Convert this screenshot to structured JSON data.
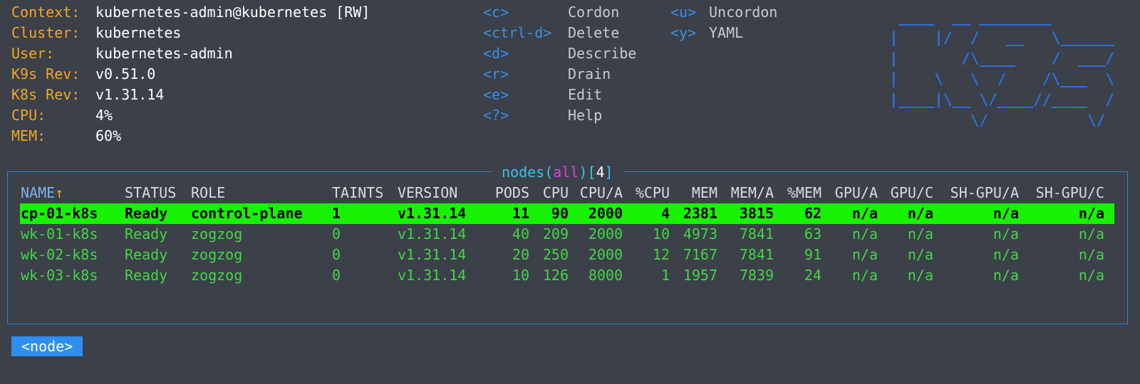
{
  "header": {
    "info": [
      {
        "label": "Context:",
        "value": "kubernetes-admin@kubernetes [RW]"
      },
      {
        "label": "Cluster:",
        "value": "kubernetes"
      },
      {
        "label": "User:",
        "value": "kubernetes-admin"
      },
      {
        "label": "K9s Rev:",
        "value": "v0.51.0"
      },
      {
        "label": "K8s Rev:",
        "value": "v1.31.14"
      },
      {
        "label": "CPU:",
        "value": "4%"
      },
      {
        "label": "MEM:",
        "value": "60%"
      }
    ],
    "shortcuts": [
      {
        "key": "<c>",
        "action": "Cordon"
      },
      {
        "key": "<ctrl-d>",
        "action": "Delete"
      },
      {
        "key": "<d>",
        "action": "Describe"
      },
      {
        "key": "<r>",
        "action": "Drain"
      },
      {
        "key": "<e>",
        "action": "Edit"
      },
      {
        "key": "<?>",
        "action": "Help"
      },
      {
        "key": "<u>",
        "action": "Uncordon"
      },
      {
        "key": "<y>",
        "action": "YAML"
      }
    ],
    "logo": " ____  __ ________       \n|    |/  /   __   \\______\n|       /\\____    /  ___/\n|    \\   \\  /    /\\___  \\\n|____|\\__ \\/____//____  /\n         \\/           \\/ "
  },
  "table": {
    "title_resource": "nodes",
    "title_open": "(",
    "title_ns": "all",
    "title_close": ")",
    "title_count_open": "[",
    "title_count": "4",
    "title_count_close": "]",
    "columns": [
      "NAME↑",
      "STATUS",
      "ROLE",
      "TAINTS",
      "VERSION",
      "PODS",
      "CPU",
      "CPU/A",
      "%CPU",
      "MEM",
      "MEM/A",
      "%MEM",
      "GPU/A",
      "GPU/C",
      "SH-GPU/A",
      "SH-GPU/C"
    ],
    "rows": [
      [
        "cp-01-k8s",
        "Ready",
        "control-plane",
        "1",
        "v1.31.14",
        "11",
        "90",
        "2000",
        "4",
        "2381",
        "3815",
        "62",
        "n/a",
        "n/a",
        "n/a",
        "n/a"
      ],
      [
        "wk-01-k8s",
        "Ready",
        "zogzog",
        "0",
        "v1.31.14",
        "40",
        "209",
        "2000",
        "10",
        "4973",
        "7841",
        "63",
        "n/a",
        "n/a",
        "n/a",
        "n/a"
      ],
      [
        "wk-02-k8s",
        "Ready",
        "zogzog",
        "0",
        "v1.31.14",
        "20",
        "250",
        "2000",
        "12",
        "7167",
        "7841",
        "91",
        "n/a",
        "n/a",
        "n/a",
        "n/a"
      ],
      [
        "wk-03-k8s",
        "Ready",
        "zogzog",
        "0",
        "v1.31.14",
        "10",
        "126",
        "8000",
        "1",
        "1957",
        "7839",
        "24",
        "n/a",
        "n/a",
        "n/a",
        "n/a"
      ]
    ],
    "selected_row": 0
  },
  "breadcrumb": "<node>",
  "colors": {
    "background": "#3b4049",
    "label": "#f5a623",
    "key": "#3a8ee6",
    "row": "#43d643",
    "selection": "#17f200",
    "frame": "#3a7fd6",
    "crumb": "#2e8ff0"
  }
}
